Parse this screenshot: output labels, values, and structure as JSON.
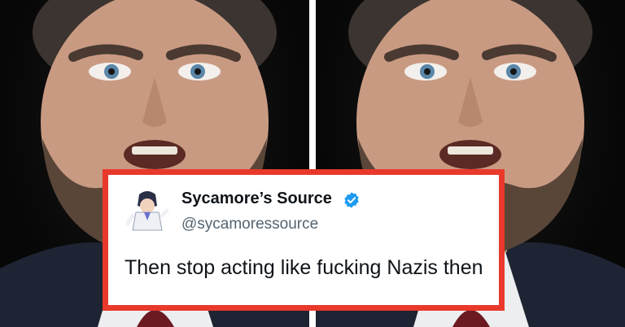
{
  "tweet": {
    "display_name": "Sycamore’s Source",
    "handle": "@sycamoressource",
    "text": "Then stop acting like fucking Nazis then",
    "verified": true,
    "verified_icon": "verified-badge-icon",
    "avatar_icon": "cartoon-character-avatar"
  },
  "colors": {
    "card_border": "#e8392b",
    "verified_badge": "#1d9bf0",
    "name_text": "#0f1419",
    "handle_text": "#536471"
  },
  "photos": [
    {
      "subject": "man-face-closeup",
      "side": "left"
    },
    {
      "subject": "man-face-closeup",
      "side": "right"
    }
  ]
}
